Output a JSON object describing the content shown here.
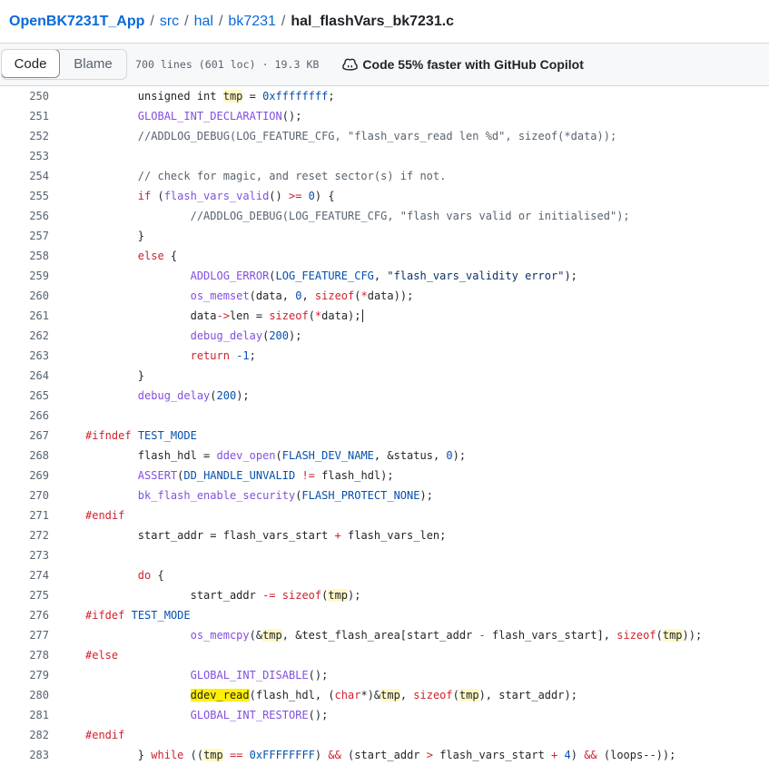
{
  "breadcrumb": {
    "repo": "OpenBK7231T_App",
    "sep": "/",
    "dir1": "src",
    "dir2": "hal",
    "dir3": "bk7231",
    "file": "hal_flashVars_bk7231.c"
  },
  "toolbar": {
    "code_label": "Code",
    "blame_label": "Blame",
    "file_info": "700 lines (601 loc) · 19.3 KB",
    "copilot_label": "Code 55% faster with GitHub Copilot",
    "copilot_icon": "copilot-icon"
  },
  "colors": {
    "link": "#0969da",
    "keyword": "#cf222e",
    "function": "#8250df",
    "comment": "#59636e",
    "number": "#0550ae",
    "string": "#0a3069",
    "highlight": "#fff8c5",
    "selection": "#fff000"
  },
  "code_lines": [
    {
      "n": "250",
      "t": [
        [
          "        unsigned int ",
          ""
        ],
        [
          "tmp",
          "hl"
        ],
        [
          " = ",
          ""
        ],
        [
          "0xffffffff",
          "nu"
        ],
        [
          ";",
          ""
        ]
      ]
    },
    {
      "n": "251",
      "t": [
        [
          "        ",
          ""
        ],
        [
          "GLOBAL_INT_DECLARATION",
          "fn"
        ],
        [
          "();",
          ""
        ]
      ]
    },
    {
      "n": "252",
      "t": [
        [
          "        //ADDLOG_DEBUG(LOG_FEATURE_CFG, \"flash_vars_read len %d\", sizeof(*data));",
          "co"
        ]
      ]
    },
    {
      "n": "253",
      "t": []
    },
    {
      "n": "254",
      "t": [
        [
          "        // check for magic, and reset sector(s) if not.",
          "co"
        ]
      ]
    },
    {
      "n": "255",
      "t": [
        [
          "        ",
          ""
        ],
        [
          "if",
          "kw"
        ],
        [
          " (",
          ""
        ],
        [
          "flash_vars_valid",
          "fn"
        ],
        [
          "() ",
          ""
        ],
        [
          ">=",
          "kw"
        ],
        [
          " ",
          ""
        ],
        [
          "0",
          "nu"
        ],
        [
          ") {",
          ""
        ]
      ]
    },
    {
      "n": "256",
      "t": [
        [
          "                //ADDLOG_DEBUG(LOG_FEATURE_CFG, \"flash vars valid or initialised\");",
          "co"
        ]
      ]
    },
    {
      "n": "257",
      "t": [
        [
          "        }",
          ""
        ]
      ]
    },
    {
      "n": "258",
      "t": [
        [
          "        ",
          ""
        ],
        [
          "else",
          "kw"
        ],
        [
          " {",
          ""
        ]
      ]
    },
    {
      "n": "259",
      "t": [
        [
          "                ",
          ""
        ],
        [
          "ADDLOG_ERROR",
          "fn"
        ],
        [
          "(",
          ""
        ],
        [
          "LOG_FEATURE_CFG",
          "mc"
        ],
        [
          ", ",
          ""
        ],
        [
          "\"flash_vars_validity error\"",
          "st"
        ],
        [
          ");",
          ""
        ]
      ]
    },
    {
      "n": "260",
      "t": [
        [
          "                ",
          ""
        ],
        [
          "os_memset",
          "fn"
        ],
        [
          "(data, ",
          ""
        ],
        [
          "0",
          "nu"
        ],
        [
          ", ",
          ""
        ],
        [
          "sizeof",
          "kw"
        ],
        [
          "(",
          ""
        ],
        [
          "*",
          "kw"
        ],
        [
          "data));",
          ""
        ]
      ]
    },
    {
      "n": "261",
      "t": [
        [
          "                data",
          ""
        ],
        [
          "->",
          "kw"
        ],
        [
          "len",
          ""
        ],
        [
          " = ",
          ""
        ],
        [
          "sizeof",
          "kw"
        ],
        [
          "(",
          ""
        ],
        [
          "*",
          "kw"
        ],
        [
          "data);",
          ""
        ],
        [
          "",
          "caret"
        ]
      ]
    },
    {
      "n": "262",
      "t": [
        [
          "                ",
          ""
        ],
        [
          "debug_delay",
          "fn"
        ],
        [
          "(",
          ""
        ],
        [
          "200",
          "nu"
        ],
        [
          ");",
          ""
        ]
      ]
    },
    {
      "n": "263",
      "t": [
        [
          "                ",
          ""
        ],
        [
          "return",
          "kw"
        ],
        [
          " ",
          ""
        ],
        [
          "-1",
          "nu"
        ],
        [
          ";",
          ""
        ]
      ]
    },
    {
      "n": "264",
      "t": [
        [
          "        }",
          ""
        ]
      ]
    },
    {
      "n": "265",
      "t": [
        [
          "        ",
          ""
        ],
        [
          "debug_delay",
          "fn"
        ],
        [
          "(",
          ""
        ],
        [
          "200",
          "nu"
        ],
        [
          ");",
          ""
        ]
      ]
    },
    {
      "n": "266",
      "t": []
    },
    {
      "n": "267",
      "t": [
        [
          "#ifndef",
          "kw"
        ],
        [
          " ",
          ""
        ],
        [
          "TEST_MODE",
          "mc"
        ]
      ]
    },
    {
      "n": "268",
      "t": [
        [
          "        flash_hdl = ",
          ""
        ],
        [
          "ddev_open",
          "fn"
        ],
        [
          "(",
          ""
        ],
        [
          "FLASH_DEV_NAME",
          "mc"
        ],
        [
          ", &status, ",
          ""
        ],
        [
          "0",
          "nu"
        ],
        [
          ");",
          ""
        ]
      ]
    },
    {
      "n": "269",
      "t": [
        [
          "        ",
          ""
        ],
        [
          "ASSERT",
          "fn"
        ],
        [
          "(",
          ""
        ],
        [
          "DD_HANDLE_UNVALID",
          "mc"
        ],
        [
          " ",
          ""
        ],
        [
          "!=",
          "kw"
        ],
        [
          " flash_hdl);",
          ""
        ]
      ]
    },
    {
      "n": "270",
      "t": [
        [
          "        ",
          ""
        ],
        [
          "bk_flash_enable_security",
          "fn"
        ],
        [
          "(",
          ""
        ],
        [
          "FLASH_PROTECT_NONE",
          "mc"
        ],
        [
          ");",
          ""
        ]
      ]
    },
    {
      "n": "271",
      "t": [
        [
          "#endif",
          "kw"
        ]
      ]
    },
    {
      "n": "272",
      "t": [
        [
          "        start_addr = flash_vars_start ",
          ""
        ],
        [
          "+",
          "kw"
        ],
        [
          " flash_vars_len;",
          ""
        ]
      ]
    },
    {
      "n": "273",
      "t": []
    },
    {
      "n": "274",
      "t": [
        [
          "        ",
          ""
        ],
        [
          "do",
          "kw"
        ],
        [
          " {",
          ""
        ]
      ]
    },
    {
      "n": "275",
      "t": [
        [
          "                start_addr ",
          ""
        ],
        [
          "-=",
          "kw"
        ],
        [
          " ",
          ""
        ],
        [
          "sizeof",
          "kw"
        ],
        [
          "(",
          ""
        ],
        [
          "tmp",
          "hl"
        ],
        [
          ");",
          ""
        ]
      ]
    },
    {
      "n": "276",
      "t": [
        [
          "#ifdef",
          "kw"
        ],
        [
          " ",
          ""
        ],
        [
          "TEST_MODE",
          "mc"
        ]
      ]
    },
    {
      "n": "277",
      "t": [
        [
          "                ",
          ""
        ],
        [
          "os_memcpy",
          "fn"
        ],
        [
          "(&",
          ""
        ],
        [
          "tmp",
          "hl"
        ],
        [
          ", &test_flash_area[start_addr ",
          ""
        ],
        [
          "-",
          "kw"
        ],
        [
          " flash_vars_start], ",
          ""
        ],
        [
          "sizeof",
          "kw"
        ],
        [
          "(",
          ""
        ],
        [
          "tmp",
          "hl"
        ],
        [
          "));",
          ""
        ]
      ]
    },
    {
      "n": "278",
      "t": [
        [
          "#else",
          "kw"
        ]
      ]
    },
    {
      "n": "279",
      "t": [
        [
          "                ",
          ""
        ],
        [
          "GLOBAL_INT_DISABLE",
          "fn"
        ],
        [
          "();",
          ""
        ]
      ]
    },
    {
      "n": "280",
      "t": [
        [
          "                ",
          ""
        ],
        [
          "ddev_read",
          "hls"
        ],
        [
          "(flash_hdl, (",
          ""
        ],
        [
          "char",
          "kw"
        ],
        [
          "*",
          ""
        ],
        [
          ")&",
          ""
        ],
        [
          "tmp",
          "hl"
        ],
        [
          ", ",
          ""
        ],
        [
          "sizeof",
          "kw"
        ],
        [
          "(",
          ""
        ],
        [
          "tmp",
          "hl"
        ],
        [
          "), start_addr);",
          ""
        ]
      ]
    },
    {
      "n": "281",
      "t": [
        [
          "                ",
          ""
        ],
        [
          "GLOBAL_INT_RESTORE",
          "fn"
        ],
        [
          "();",
          ""
        ]
      ]
    },
    {
      "n": "282",
      "t": [
        [
          "#endif",
          "kw"
        ]
      ]
    },
    {
      "n": "283",
      "t": [
        [
          "        } ",
          ""
        ],
        [
          "while",
          "kw"
        ],
        [
          " ((",
          ""
        ],
        [
          "tmp",
          "hl"
        ],
        [
          " ",
          ""
        ],
        [
          "==",
          "kw"
        ],
        [
          " ",
          ""
        ],
        [
          "0xFFFFFFFF",
          "nu"
        ],
        [
          ") ",
          ""
        ],
        [
          "&&",
          "kw"
        ],
        [
          " (start_addr ",
          ""
        ],
        [
          ">",
          "kw"
        ],
        [
          " flash_vars_start ",
          ""
        ],
        [
          "+",
          "kw"
        ],
        [
          " ",
          ""
        ],
        [
          "4",
          "nu"
        ],
        [
          ") ",
          ""
        ],
        [
          "&&",
          "kw"
        ],
        [
          " (loops--));",
          ""
        ]
      ]
    }
  ]
}
